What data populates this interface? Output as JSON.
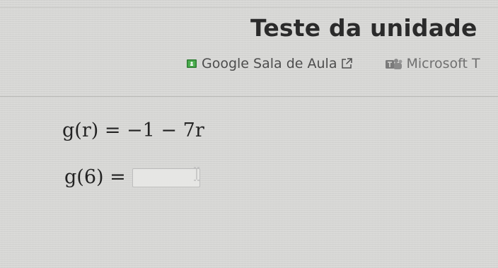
{
  "page": {
    "title": "Teste da unidade"
  },
  "share": {
    "google_classroom_label": "Google Sala de Aula",
    "microsoft_teams_label": "Microsoft T",
    "google_classroom_icon": "google-classroom-icon",
    "external_link_icon": "external-link-icon",
    "microsoft_teams_icon": "microsoft-teams-icon"
  },
  "problem": {
    "definition": "g(r) = −1 − 7r",
    "prompt": "g(6) =",
    "answer_value": ""
  },
  "colors": {
    "background": "#d9d9d7",
    "title_text": "#2b2b2b",
    "link_text": "#4d4d4d",
    "classroom_icon": "#2e7d32",
    "input_border": "#bdbdbd"
  }
}
